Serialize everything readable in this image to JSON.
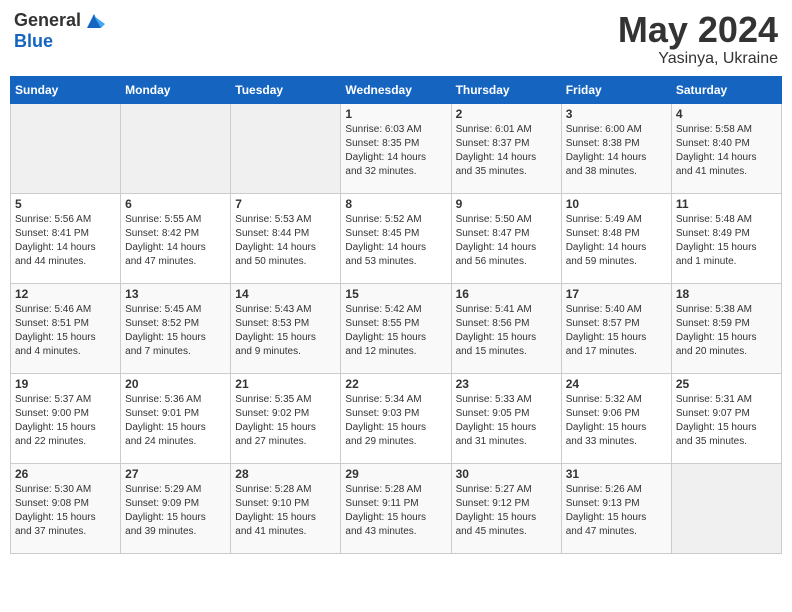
{
  "header": {
    "logo_general": "General",
    "logo_blue": "Blue",
    "month": "May 2024",
    "location": "Yasinya, Ukraine"
  },
  "weekdays": [
    "Sunday",
    "Monday",
    "Tuesday",
    "Wednesday",
    "Thursday",
    "Friday",
    "Saturday"
  ],
  "weeks": [
    [
      {
        "day": "",
        "info": ""
      },
      {
        "day": "",
        "info": ""
      },
      {
        "day": "",
        "info": ""
      },
      {
        "day": "1",
        "info": "Sunrise: 6:03 AM\nSunset: 8:35 PM\nDaylight: 14 hours\nand 32 minutes."
      },
      {
        "day": "2",
        "info": "Sunrise: 6:01 AM\nSunset: 8:37 PM\nDaylight: 14 hours\nand 35 minutes."
      },
      {
        "day": "3",
        "info": "Sunrise: 6:00 AM\nSunset: 8:38 PM\nDaylight: 14 hours\nand 38 minutes."
      },
      {
        "day": "4",
        "info": "Sunrise: 5:58 AM\nSunset: 8:40 PM\nDaylight: 14 hours\nand 41 minutes."
      }
    ],
    [
      {
        "day": "5",
        "info": "Sunrise: 5:56 AM\nSunset: 8:41 PM\nDaylight: 14 hours\nand 44 minutes."
      },
      {
        "day": "6",
        "info": "Sunrise: 5:55 AM\nSunset: 8:42 PM\nDaylight: 14 hours\nand 47 minutes."
      },
      {
        "day": "7",
        "info": "Sunrise: 5:53 AM\nSunset: 8:44 PM\nDaylight: 14 hours\nand 50 minutes."
      },
      {
        "day": "8",
        "info": "Sunrise: 5:52 AM\nSunset: 8:45 PM\nDaylight: 14 hours\nand 53 minutes."
      },
      {
        "day": "9",
        "info": "Sunrise: 5:50 AM\nSunset: 8:47 PM\nDaylight: 14 hours\nand 56 minutes."
      },
      {
        "day": "10",
        "info": "Sunrise: 5:49 AM\nSunset: 8:48 PM\nDaylight: 14 hours\nand 59 minutes."
      },
      {
        "day": "11",
        "info": "Sunrise: 5:48 AM\nSunset: 8:49 PM\nDaylight: 15 hours\nand 1 minute."
      }
    ],
    [
      {
        "day": "12",
        "info": "Sunrise: 5:46 AM\nSunset: 8:51 PM\nDaylight: 15 hours\nand 4 minutes."
      },
      {
        "day": "13",
        "info": "Sunrise: 5:45 AM\nSunset: 8:52 PM\nDaylight: 15 hours\nand 7 minutes."
      },
      {
        "day": "14",
        "info": "Sunrise: 5:43 AM\nSunset: 8:53 PM\nDaylight: 15 hours\nand 9 minutes."
      },
      {
        "day": "15",
        "info": "Sunrise: 5:42 AM\nSunset: 8:55 PM\nDaylight: 15 hours\nand 12 minutes."
      },
      {
        "day": "16",
        "info": "Sunrise: 5:41 AM\nSunset: 8:56 PM\nDaylight: 15 hours\nand 15 minutes."
      },
      {
        "day": "17",
        "info": "Sunrise: 5:40 AM\nSunset: 8:57 PM\nDaylight: 15 hours\nand 17 minutes."
      },
      {
        "day": "18",
        "info": "Sunrise: 5:38 AM\nSunset: 8:59 PM\nDaylight: 15 hours\nand 20 minutes."
      }
    ],
    [
      {
        "day": "19",
        "info": "Sunrise: 5:37 AM\nSunset: 9:00 PM\nDaylight: 15 hours\nand 22 minutes."
      },
      {
        "day": "20",
        "info": "Sunrise: 5:36 AM\nSunset: 9:01 PM\nDaylight: 15 hours\nand 24 minutes."
      },
      {
        "day": "21",
        "info": "Sunrise: 5:35 AM\nSunset: 9:02 PM\nDaylight: 15 hours\nand 27 minutes."
      },
      {
        "day": "22",
        "info": "Sunrise: 5:34 AM\nSunset: 9:03 PM\nDaylight: 15 hours\nand 29 minutes."
      },
      {
        "day": "23",
        "info": "Sunrise: 5:33 AM\nSunset: 9:05 PM\nDaylight: 15 hours\nand 31 minutes."
      },
      {
        "day": "24",
        "info": "Sunrise: 5:32 AM\nSunset: 9:06 PM\nDaylight: 15 hours\nand 33 minutes."
      },
      {
        "day": "25",
        "info": "Sunrise: 5:31 AM\nSunset: 9:07 PM\nDaylight: 15 hours\nand 35 minutes."
      }
    ],
    [
      {
        "day": "26",
        "info": "Sunrise: 5:30 AM\nSunset: 9:08 PM\nDaylight: 15 hours\nand 37 minutes."
      },
      {
        "day": "27",
        "info": "Sunrise: 5:29 AM\nSunset: 9:09 PM\nDaylight: 15 hours\nand 39 minutes."
      },
      {
        "day": "28",
        "info": "Sunrise: 5:28 AM\nSunset: 9:10 PM\nDaylight: 15 hours\nand 41 minutes."
      },
      {
        "day": "29",
        "info": "Sunrise: 5:28 AM\nSunset: 9:11 PM\nDaylight: 15 hours\nand 43 minutes."
      },
      {
        "day": "30",
        "info": "Sunrise: 5:27 AM\nSunset: 9:12 PM\nDaylight: 15 hours\nand 45 minutes."
      },
      {
        "day": "31",
        "info": "Sunrise: 5:26 AM\nSunset: 9:13 PM\nDaylight: 15 hours\nand 47 minutes."
      },
      {
        "day": "",
        "info": ""
      }
    ]
  ]
}
